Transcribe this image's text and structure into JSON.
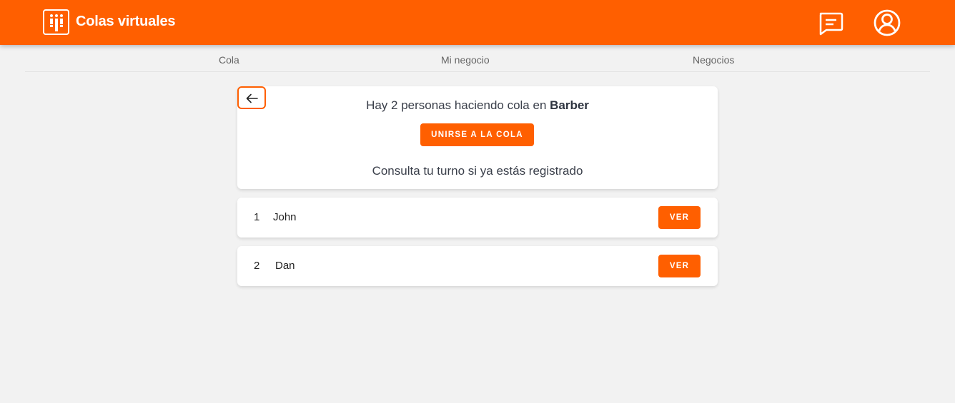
{
  "app": {
    "title": "Colas virtuales",
    "brand_color": "#ff5f00"
  },
  "header": {
    "icons": [
      "logo-queue-icon",
      "chat-icon",
      "user-account-icon"
    ]
  },
  "nav": {
    "items": [
      {
        "label": "Cola"
      },
      {
        "label": "Mi negocio"
      },
      {
        "label": "Negocios"
      }
    ]
  },
  "queue": {
    "prefix": "Hay 2 personas haciendo cola en ",
    "business_name": "Barber",
    "join_label": "UNIRSE A LA COLA",
    "consulta_text": "Consulta tu turno si ya estás registrado",
    "back_icon": "arrow-left-icon"
  },
  "entries": [
    {
      "position": "1",
      "name": "John",
      "button": "VER"
    },
    {
      "position": "2",
      "name": "Dan",
      "button": "VER"
    }
  ]
}
